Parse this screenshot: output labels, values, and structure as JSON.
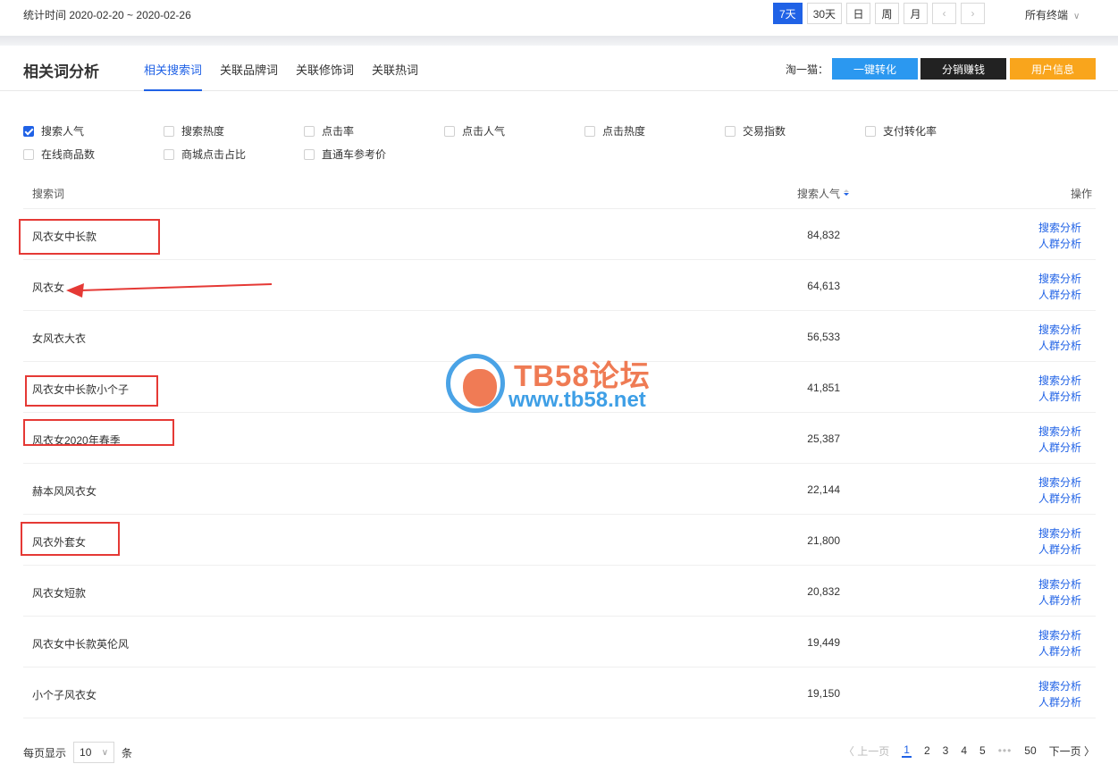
{
  "topbar": {
    "stat_label": "统计时间 2020-02-20 ~ 2020-02-26",
    "ranges": [
      "7天",
      "30天",
      "日",
      "周",
      "月"
    ],
    "prev_icon": "chevron-left-icon",
    "next_icon": "chevron-right-icon",
    "terminal": "所有终端"
  },
  "section": {
    "title": "相关词分析",
    "tabs": [
      "相关搜索词",
      "关联品牌词",
      "关联修饰词",
      "关联热词"
    ],
    "taoyimao_label": "淘一猫：",
    "btn_convert": "一键转化",
    "btn_distribute": "分销赚钱",
    "btn_userinfo": "用户信息",
    "colors": {
      "accent": "#2062e6",
      "convert": "#2b98f0",
      "distribute": "#222222",
      "userinfo": "#f9a51c"
    }
  },
  "checkboxes": [
    {
      "label": "搜索人气",
      "checked": true
    },
    {
      "label": "搜索热度",
      "checked": false
    },
    {
      "label": "点击率",
      "checked": false
    },
    {
      "label": "点击人气",
      "checked": false
    },
    {
      "label": "点击热度",
      "checked": false
    },
    {
      "label": "交易指数",
      "checked": false
    },
    {
      "label": "支付转化率",
      "checked": false
    },
    {
      "label": "在线商品数",
      "checked": false
    },
    {
      "label": "商城点击占比",
      "checked": false
    },
    {
      "label": "直通车参考价",
      "checked": false
    }
  ],
  "table": {
    "headers": {
      "keyword": "搜索词",
      "popularity": "搜索人气",
      "ops": "操作"
    },
    "op_search": "搜索分析",
    "op_crowd": "人群分析",
    "rows": [
      {
        "keyword": "风衣女中长款",
        "value": "84,832"
      },
      {
        "keyword": "风衣女",
        "value": "64,613"
      },
      {
        "keyword": "女风衣大衣",
        "value": "56,533"
      },
      {
        "keyword": "风衣女中长款小个子",
        "value": "41,851"
      },
      {
        "keyword": "风衣女2020年春季",
        "value": "25,387"
      },
      {
        "keyword": "赫本风风衣女",
        "value": "22,144"
      },
      {
        "keyword": "风衣外套女",
        "value": "21,800"
      },
      {
        "keyword": "风衣女短款",
        "value": "20,832"
      },
      {
        "keyword": "风衣女中长款英伦风",
        "value": "19,449"
      },
      {
        "keyword": "小个子风衣女",
        "value": "19,150"
      }
    ]
  },
  "watermark": {
    "title": "TB58论坛",
    "url": "www.tb58.net"
  },
  "pager": {
    "per_page_label": "每页显示",
    "per_page_value": "10",
    "per_page_unit": "条",
    "prev": "〈 上一页",
    "pages": [
      "1",
      "2",
      "3",
      "4",
      "5"
    ],
    "dots": "•••",
    "last": "50",
    "next": "下一页 〉"
  }
}
